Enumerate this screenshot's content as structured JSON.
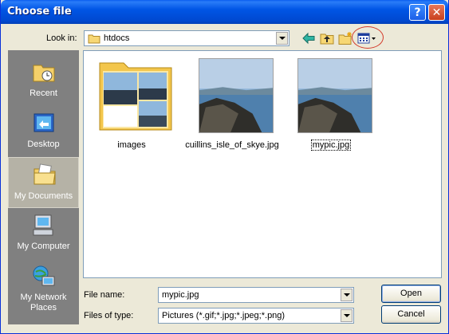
{
  "window": {
    "title": "Choose file"
  },
  "look_in": {
    "label": "Look in:",
    "value": "htdocs"
  },
  "places": [
    {
      "label": "Recent",
      "icon": "recent-documents-icon"
    },
    {
      "label": "Desktop",
      "icon": "desktop-icon"
    },
    {
      "label": "My Documents",
      "icon": "my-documents-icon",
      "active": true
    },
    {
      "label": "My Computer",
      "icon": "my-computer-icon"
    },
    {
      "label": "My Network Places",
      "icon": "network-places-icon"
    }
  ],
  "files": [
    {
      "name": "images",
      "type": "folder"
    },
    {
      "name": "cuillins_isle_of_skye.jpg",
      "type": "image"
    },
    {
      "name": "mypic.jpg",
      "type": "image",
      "selected": true
    }
  ],
  "file_name": {
    "label": "File name:",
    "value": "mypic.jpg"
  },
  "file_type": {
    "label": "Files of type:",
    "value": "Pictures (*.gif;*.jpg;*.jpeg;*.png)"
  },
  "buttons": {
    "open": "Open",
    "cancel": "Cancel"
  },
  "titlebar": {
    "help": "?",
    "close": "✕"
  },
  "colors": {
    "titlebar": "#0055e5",
    "places_bg": "#808080",
    "highlight_circle": "#d43a2a"
  }
}
